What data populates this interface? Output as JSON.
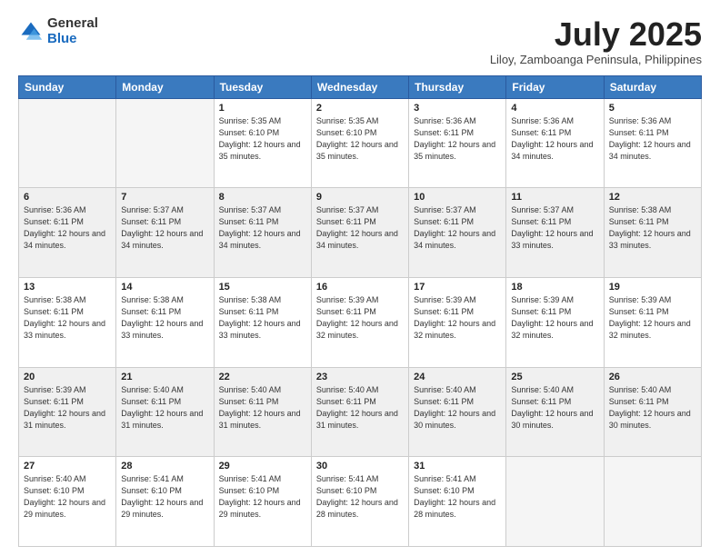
{
  "logo": {
    "general": "General",
    "blue": "Blue"
  },
  "title": {
    "month_year": "July 2025",
    "location": "Liloy, Zamboanga Peninsula, Philippines"
  },
  "headers": [
    "Sunday",
    "Monday",
    "Tuesday",
    "Wednesday",
    "Thursday",
    "Friday",
    "Saturday"
  ],
  "weeks": [
    [
      {
        "day": "",
        "info": ""
      },
      {
        "day": "",
        "info": ""
      },
      {
        "day": "1",
        "info": "Sunrise: 5:35 AM\nSunset: 6:10 PM\nDaylight: 12 hours and 35 minutes."
      },
      {
        "day": "2",
        "info": "Sunrise: 5:35 AM\nSunset: 6:10 PM\nDaylight: 12 hours and 35 minutes."
      },
      {
        "day": "3",
        "info": "Sunrise: 5:36 AM\nSunset: 6:11 PM\nDaylight: 12 hours and 35 minutes."
      },
      {
        "day": "4",
        "info": "Sunrise: 5:36 AM\nSunset: 6:11 PM\nDaylight: 12 hours and 34 minutes."
      },
      {
        "day": "5",
        "info": "Sunrise: 5:36 AM\nSunset: 6:11 PM\nDaylight: 12 hours and 34 minutes."
      }
    ],
    [
      {
        "day": "6",
        "info": "Sunrise: 5:36 AM\nSunset: 6:11 PM\nDaylight: 12 hours and 34 minutes."
      },
      {
        "day": "7",
        "info": "Sunrise: 5:37 AM\nSunset: 6:11 PM\nDaylight: 12 hours and 34 minutes."
      },
      {
        "day": "8",
        "info": "Sunrise: 5:37 AM\nSunset: 6:11 PM\nDaylight: 12 hours and 34 minutes."
      },
      {
        "day": "9",
        "info": "Sunrise: 5:37 AM\nSunset: 6:11 PM\nDaylight: 12 hours and 34 minutes."
      },
      {
        "day": "10",
        "info": "Sunrise: 5:37 AM\nSunset: 6:11 PM\nDaylight: 12 hours and 34 minutes."
      },
      {
        "day": "11",
        "info": "Sunrise: 5:37 AM\nSunset: 6:11 PM\nDaylight: 12 hours and 33 minutes."
      },
      {
        "day": "12",
        "info": "Sunrise: 5:38 AM\nSunset: 6:11 PM\nDaylight: 12 hours and 33 minutes."
      }
    ],
    [
      {
        "day": "13",
        "info": "Sunrise: 5:38 AM\nSunset: 6:11 PM\nDaylight: 12 hours and 33 minutes."
      },
      {
        "day": "14",
        "info": "Sunrise: 5:38 AM\nSunset: 6:11 PM\nDaylight: 12 hours and 33 minutes."
      },
      {
        "day": "15",
        "info": "Sunrise: 5:38 AM\nSunset: 6:11 PM\nDaylight: 12 hours and 33 minutes."
      },
      {
        "day": "16",
        "info": "Sunrise: 5:39 AM\nSunset: 6:11 PM\nDaylight: 12 hours and 32 minutes."
      },
      {
        "day": "17",
        "info": "Sunrise: 5:39 AM\nSunset: 6:11 PM\nDaylight: 12 hours and 32 minutes."
      },
      {
        "day": "18",
        "info": "Sunrise: 5:39 AM\nSunset: 6:11 PM\nDaylight: 12 hours and 32 minutes."
      },
      {
        "day": "19",
        "info": "Sunrise: 5:39 AM\nSunset: 6:11 PM\nDaylight: 12 hours and 32 minutes."
      }
    ],
    [
      {
        "day": "20",
        "info": "Sunrise: 5:39 AM\nSunset: 6:11 PM\nDaylight: 12 hours and 31 minutes."
      },
      {
        "day": "21",
        "info": "Sunrise: 5:40 AM\nSunset: 6:11 PM\nDaylight: 12 hours and 31 minutes."
      },
      {
        "day": "22",
        "info": "Sunrise: 5:40 AM\nSunset: 6:11 PM\nDaylight: 12 hours and 31 minutes."
      },
      {
        "day": "23",
        "info": "Sunrise: 5:40 AM\nSunset: 6:11 PM\nDaylight: 12 hours and 31 minutes."
      },
      {
        "day": "24",
        "info": "Sunrise: 5:40 AM\nSunset: 6:11 PM\nDaylight: 12 hours and 30 minutes."
      },
      {
        "day": "25",
        "info": "Sunrise: 5:40 AM\nSunset: 6:11 PM\nDaylight: 12 hours and 30 minutes."
      },
      {
        "day": "26",
        "info": "Sunrise: 5:40 AM\nSunset: 6:11 PM\nDaylight: 12 hours and 30 minutes."
      }
    ],
    [
      {
        "day": "27",
        "info": "Sunrise: 5:40 AM\nSunset: 6:10 PM\nDaylight: 12 hours and 29 minutes."
      },
      {
        "day": "28",
        "info": "Sunrise: 5:41 AM\nSunset: 6:10 PM\nDaylight: 12 hours and 29 minutes."
      },
      {
        "day": "29",
        "info": "Sunrise: 5:41 AM\nSunset: 6:10 PM\nDaylight: 12 hours and 29 minutes."
      },
      {
        "day": "30",
        "info": "Sunrise: 5:41 AM\nSunset: 6:10 PM\nDaylight: 12 hours and 28 minutes."
      },
      {
        "day": "31",
        "info": "Sunrise: 5:41 AM\nSunset: 6:10 PM\nDaylight: 12 hours and 28 minutes."
      },
      {
        "day": "",
        "info": ""
      },
      {
        "day": "",
        "info": ""
      }
    ]
  ]
}
